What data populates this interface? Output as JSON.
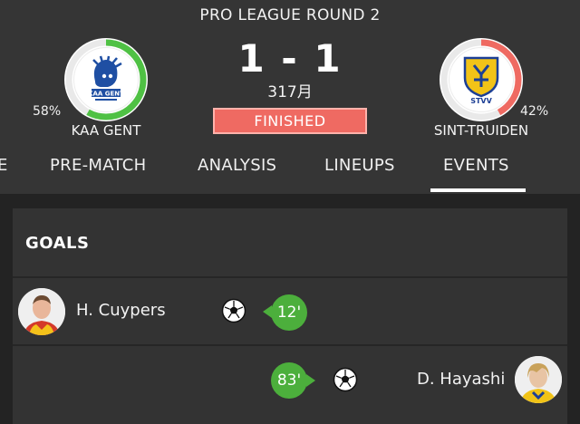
{
  "match": {
    "round_title": "PRO LEAGUE ROUND 2",
    "score": "1 - 1",
    "date": "317月",
    "status": "FINISHED"
  },
  "home": {
    "name": "KAA GENT",
    "percent": "58%",
    "percent_value": 58,
    "crest_text": "KAA GENT",
    "ring_color": "#4fc144"
  },
  "away": {
    "name": "SINT-TRUIDEN",
    "percent": "42%",
    "percent_value": 42,
    "crest_text": "STVV",
    "ring_color": "#ef6a62"
  },
  "tabs": [
    {
      "label": "E"
    },
    {
      "label": "PRE-MATCH"
    },
    {
      "label": "ANALYSIS"
    },
    {
      "label": "LINEUPS"
    },
    {
      "label": "EVENTS",
      "active": true
    }
  ],
  "goals": {
    "title": "GOALS",
    "events": [
      {
        "player": "H. Cuypers",
        "minute": "12'",
        "side": "home"
      },
      {
        "player": "D. Hayashi",
        "minute": "83'",
        "side": "away"
      }
    ]
  },
  "colors": {
    "background": "#232323",
    "header": "#353535",
    "card": "#333333",
    "goal_green": "#4caf3c",
    "finished_red": "#ef6a62"
  }
}
